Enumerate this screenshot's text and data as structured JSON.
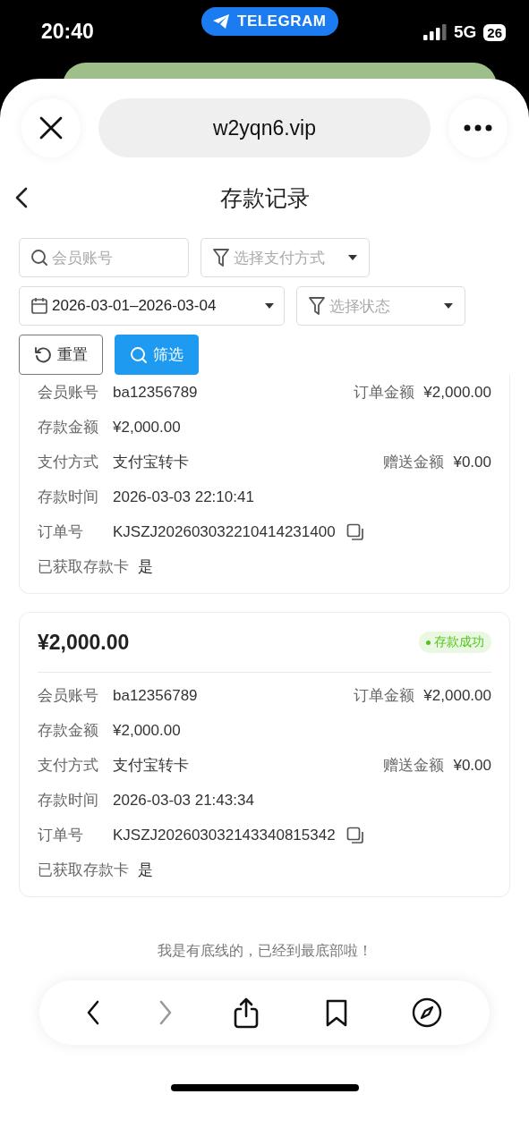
{
  "status_bar": {
    "time": "20:40",
    "app_pill": "TELEGRAM",
    "network": "5G",
    "battery": "26"
  },
  "browser": {
    "url": "w2yqn6.vip"
  },
  "page": {
    "title": "存款记录"
  },
  "filters": {
    "member_search": {
      "placeholder": "会员账号"
    },
    "payment_method": {
      "placeholder": "选择支付方式"
    },
    "date_range": {
      "value": "2026-03-01–2026-03-04"
    },
    "status": {
      "placeholder": "选择状态"
    },
    "buttons": [
      {
        "kind": "reset",
        "label": "重置"
      },
      {
        "kind": "filter",
        "label": "筛选"
      }
    ]
  },
  "records": [
    {
      "rows": [
        {
          "label": "会员账号",
          "value": "ba12356789",
          "right_label": "订单金额",
          "right_value": "¥2,000.00"
        },
        {
          "label": "存款金额",
          "value": "¥2,000.00"
        },
        {
          "label": "支付方式",
          "value": "支付宝转卡",
          "right_label": "赠送金额",
          "right_value": "¥0.00"
        },
        {
          "label": "存款时间",
          "value": "2026-03-03 22:10:41"
        },
        {
          "label": "订单号",
          "value": "KJSZJ202603032210414231400",
          "kind": "copyable"
        },
        {
          "label": "已获取存款卡",
          "value": "是"
        }
      ]
    },
    {
      "amount": "¥2,000.00",
      "status": "存款成功",
      "color": "#52c41a",
      "rows": [
        {
          "label": "会员账号",
          "value": "ba12356789",
          "right_label": "订单金额",
          "right_value": "¥2,000.00"
        },
        {
          "label": "存款金额",
          "value": "¥2,000.00"
        },
        {
          "label": "支付方式",
          "value": "支付宝转卡",
          "right_label": "赠送金额",
          "right_value": "¥0.00"
        },
        {
          "label": "存款时间",
          "value": "2026-03-03 21:43:34"
        },
        {
          "label": "订单号",
          "value": "KJSZJ202603032143340815342",
          "kind": "copyable"
        },
        {
          "label": "已获取存款卡",
          "value": "是"
        }
      ]
    }
  ],
  "end_message": "我是有底线的，已经到最底部啦！",
  "toolbar": [
    {
      "kind": "back",
      "disabled": false
    },
    {
      "kind": "forward",
      "disabled": true
    },
    {
      "kind": "share",
      "disabled": false
    },
    {
      "kind": "bookmarks",
      "disabled": false
    },
    {
      "kind": "compass",
      "disabled": false
    }
  ]
}
